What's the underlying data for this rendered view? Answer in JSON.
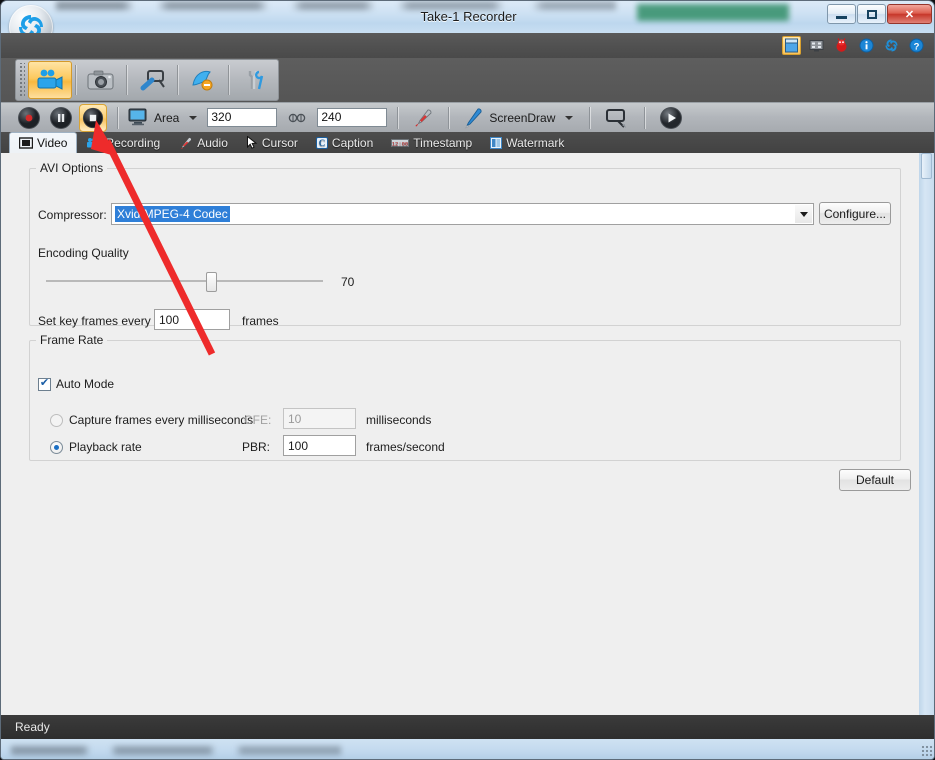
{
  "window": {
    "title": "Take-1 Recorder",
    "minimize_label": "Minimize",
    "maximize_label": "Maximize",
    "close_label": "✕",
    "logo_name": "take1-spiral-logo"
  },
  "quick_icons": [
    {
      "name": "panel-window-icon",
      "glyph": "▤",
      "selected": true
    },
    {
      "name": "screen-capture-icon",
      "glyph": "▩",
      "selected": false
    },
    {
      "name": "bug-report-icon",
      "glyph": "●",
      "selected": false
    },
    {
      "name": "info-icon",
      "glyph": "i",
      "selected": false
    },
    {
      "name": "about-logo-icon",
      "glyph": "◉",
      "selected": false
    },
    {
      "name": "help-icon",
      "glyph": "?",
      "selected": false
    }
  ],
  "main_toolbar": [
    {
      "name": "video-recorder-mode",
      "selected": true
    },
    {
      "name": "screenshot-camera-mode",
      "selected": false
    },
    {
      "name": "screen-magnifier-mode",
      "selected": false
    },
    {
      "name": "screen-draw-mode",
      "selected": false
    },
    {
      "name": "tools-settings-mode",
      "selected": false
    }
  ],
  "record_toolbar": {
    "record_label": "Record",
    "pause_label": "Pause",
    "stop_label": "Stop",
    "stop_active": true,
    "area_label": "Area",
    "width_value": "320",
    "height_value": "240",
    "link_icon_label": "lock-aspect-ratio",
    "microphone_label": "Microphone",
    "screendraw_label": "ScreenDraw",
    "callout_label": "Callout",
    "play_label": "Play"
  },
  "tabs": [
    {
      "label": "Video",
      "icon": "film-icon",
      "active": true
    },
    {
      "label": "Recording",
      "icon": "camcorder-icon",
      "active": false
    },
    {
      "label": "Audio",
      "icon": "microphone-icon",
      "active": false
    },
    {
      "label": "Cursor",
      "icon": "pointer-icon",
      "active": false
    },
    {
      "label": "Caption",
      "icon": "caption-icon",
      "active": false
    },
    {
      "label": "Timestamp",
      "icon": "timestamp-icon",
      "active": false
    },
    {
      "label": "Watermark",
      "icon": "watermark-icon",
      "active": false
    }
  ],
  "avi_options": {
    "legend": "AVI Options",
    "compressor_label": "Compressor:",
    "compressor_value": "Xvid MPEG-4 Codec",
    "configure_label": "Configure...",
    "encoding_quality_label": "Encoding Quality",
    "encoding_quality_value": "70",
    "slider_percent": 58,
    "keyframe_label": "Set key frames every",
    "keyframe_value": "100",
    "keyframe_unit": "frames"
  },
  "frame_rate": {
    "legend": "Frame Rate",
    "auto_mode_label": "Auto Mode",
    "auto_mode_checked": true,
    "capture_label": "Capture frames every milliseconds",
    "capture_selected": false,
    "cfe_label": "CFE:",
    "cfe_value": "10",
    "cfe_unit": "milliseconds",
    "playback_label": "Playback rate",
    "playback_selected": true,
    "pbr_label": "PBR:",
    "pbr_value": "100",
    "pbr_unit": "frames/second"
  },
  "footer": {
    "default_label": "Default",
    "status_text": "Ready"
  },
  "colors": {
    "accent_orange": "#f9c35e",
    "selection_blue": "#2f7fd8",
    "annotation_red": "#ee2b2b",
    "title_bar": "#cde1f3",
    "panel_bg": "#efefef",
    "dark_toolbar": "#4f4f4f",
    "status_bar": "#2e2e2e"
  },
  "annotation": {
    "arrow_name": "red-pointer-arrow",
    "points_to": "stop-button"
  }
}
